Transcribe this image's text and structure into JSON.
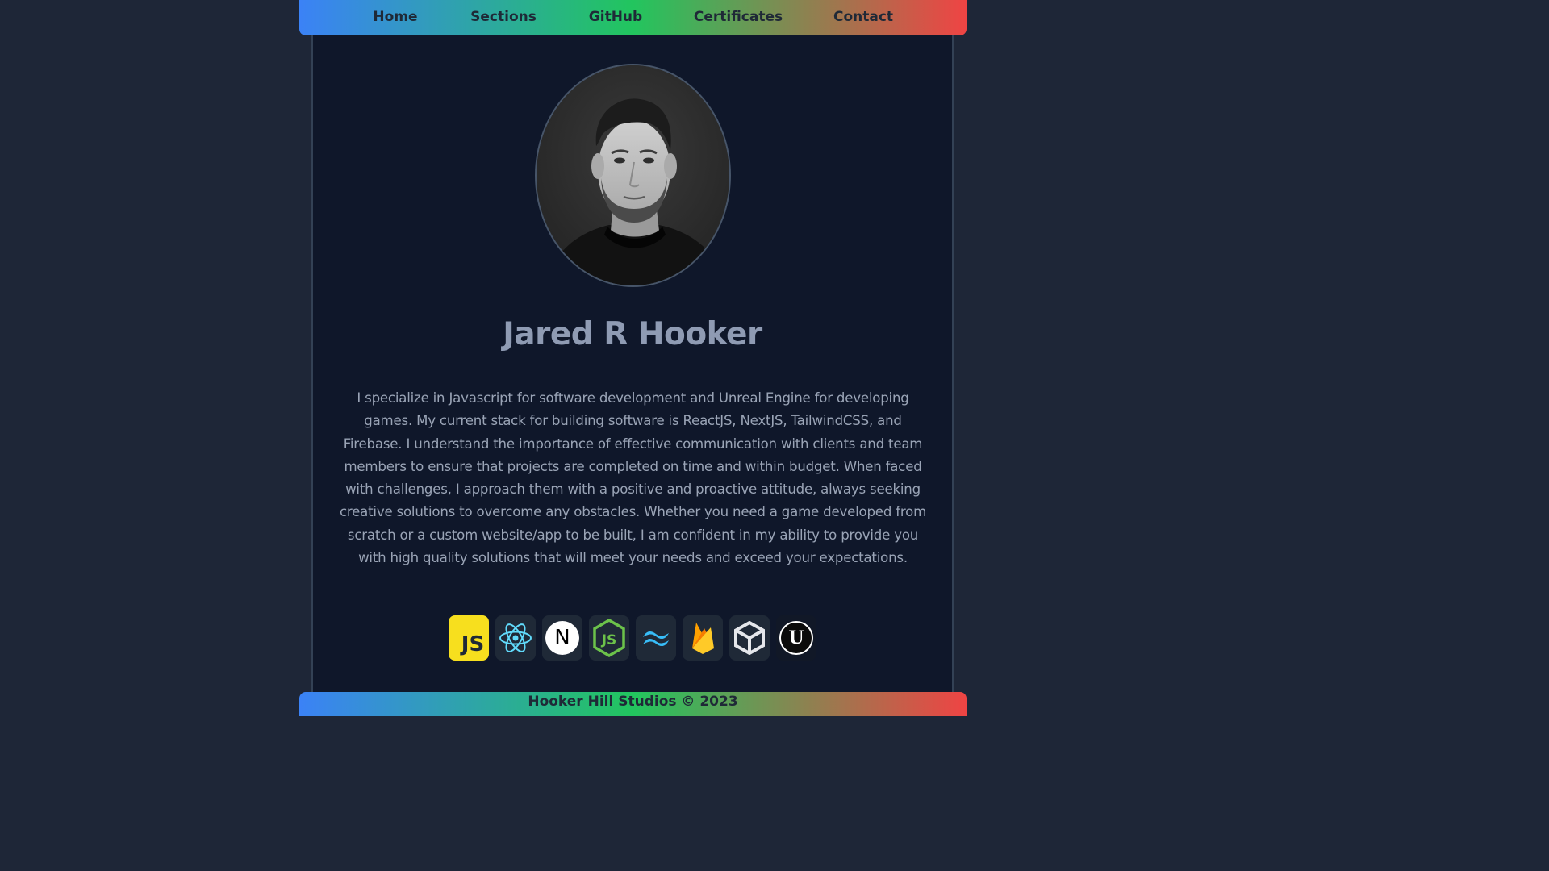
{
  "nav": {
    "items": [
      {
        "label": "Home"
      },
      {
        "label": "Sections"
      },
      {
        "label": "GitHub"
      },
      {
        "label": "Certificates"
      },
      {
        "label": "Contact"
      }
    ]
  },
  "profile": {
    "name": "Jared R Hooker",
    "bio": "I specialize in Javascript for software development and Unreal Engine for developing games. My current stack for building software is ReactJS, NextJS, TailwindCSS, and Firebase. I understand the importance of effective communication with clients and team members to ensure that projects are completed on time and within budget. When faced with challenges, I approach them with a positive and proactive attitude, always seeking creative solutions to overcome any obstacles. Whether you need a game developed from scratch or a custom website/app to be built, I am confident in my ability to provide you with high quality solutions that will meet your needs and exceed your expectations."
  },
  "tech_stack": [
    {
      "icon": "javascript-icon",
      "text": "JS"
    },
    {
      "icon": "react-icon"
    },
    {
      "icon": "nextjs-icon",
      "text": "N"
    },
    {
      "icon": "nodejs-icon",
      "text": "JS"
    },
    {
      "icon": "tailwindcss-icon"
    },
    {
      "icon": "firebase-icon"
    },
    {
      "icon": "unity-icon"
    },
    {
      "icon": "unreal-engine-icon",
      "text": "U"
    }
  ],
  "colors": {
    "background": "#1e2637",
    "panel": "#0f172a",
    "gradient": [
      "#3b82f6",
      "#22c55e",
      "#ef4444"
    ]
  },
  "footer": {
    "text": "Hooker Hill Studios © 2023"
  }
}
